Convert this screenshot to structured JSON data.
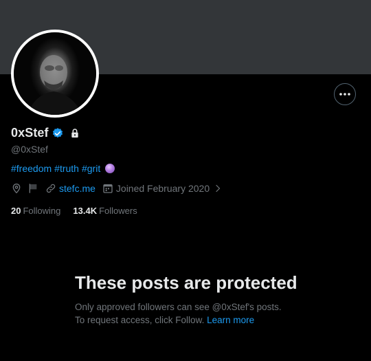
{
  "profile": {
    "display_name": "0xStef",
    "handle": "@0xStef",
    "bio_tags": [
      "#freedom",
      "#truth",
      "#grit"
    ],
    "bio_emoji": "crystal-ball",
    "link_text": "stefc.me",
    "joined": "Joined February 2020",
    "following_count": "20",
    "following_label": "Following",
    "followers_count": "13.4K",
    "followers_label": "Followers"
  },
  "protected_notice": {
    "title": "These posts are protected",
    "line1": "Only approved followers can see @0xStef's posts.",
    "line2": "To request access, click Follow.",
    "learn_more": "Learn more"
  },
  "icons": [
    "more-icon",
    "verified-badge-icon",
    "lock-icon",
    "location-icon",
    "flag-icon",
    "link-icon",
    "calendar-icon",
    "chevron-right-icon"
  ],
  "colors": {
    "accent": "#1d9bf0",
    "secondary_text": "#71767b",
    "primary_text": "#e7e9ea",
    "banner": "#333639",
    "background": "#000000"
  }
}
